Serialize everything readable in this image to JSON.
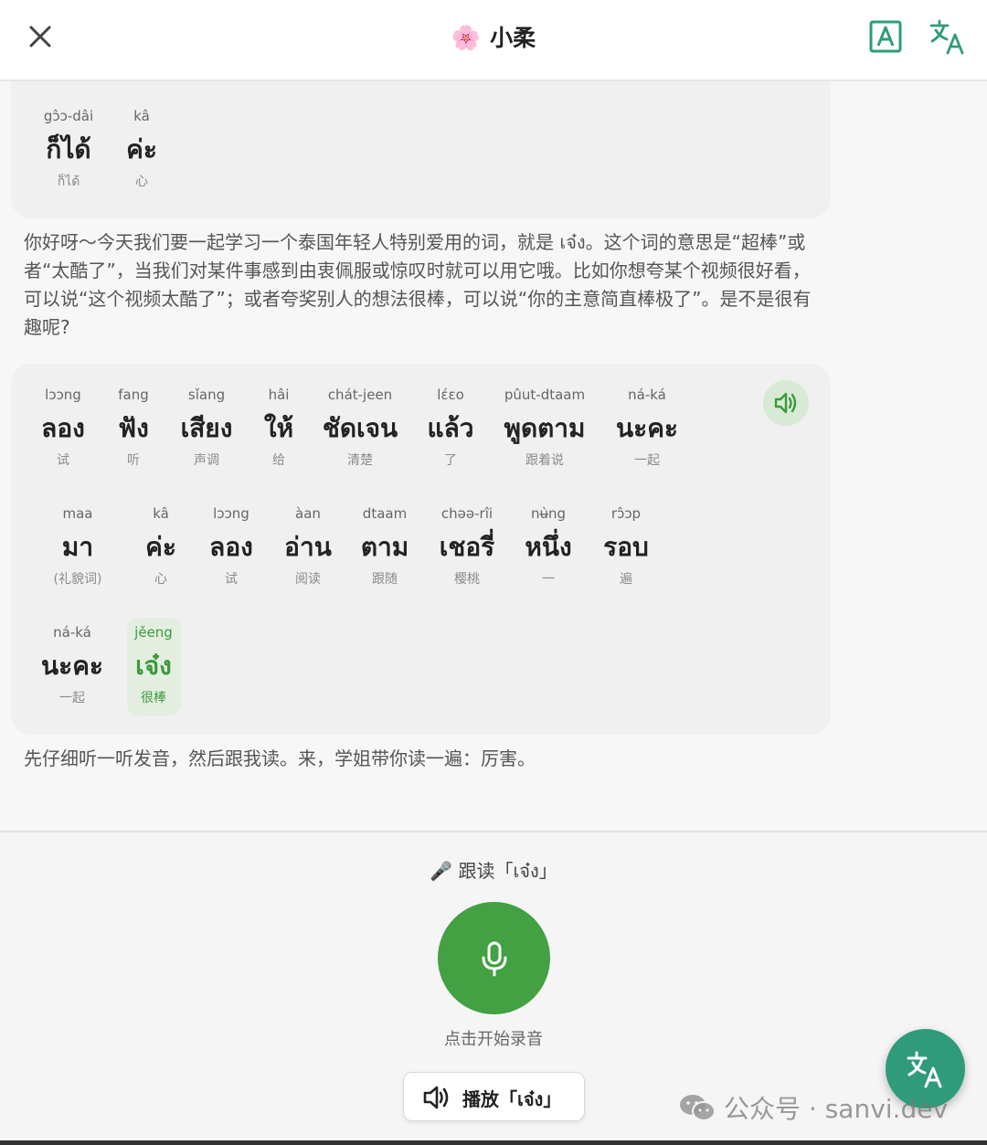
{
  "header": {
    "title": "小柔",
    "flower_emoji": "🌸",
    "accent_color": "#2f9b7a"
  },
  "card1": {
    "words": [
      {
        "rom": "gɔ̂ɔ-dâi",
        "thai": "ก็ได้",
        "mean": "ก็ได้"
      },
      {
        "rom": "kâ",
        "thai": "ค่ะ",
        "mean": "心"
      }
    ]
  },
  "paragraph1": "你好呀～今天我们要一起学习一个泰国年轻人特别爱用的词，就是 เจ๋ง。这个词的意思是“超棒”或者“太酷了”，当我们对某件事感到由衷佩服或惊叹时就可以用它哦。比如你想夸某个视频很好看，可以说“这个视频太酷了”；或者夸奖别人的想法很棒，可以说“你的主意简直棒极了”。是不是很有趣呢?",
  "card2": {
    "row1": [
      {
        "rom": "lɔɔng",
        "thai": "ลอง",
        "mean": "试"
      },
      {
        "rom": "fang",
        "thai": "ฟัง",
        "mean": "听"
      },
      {
        "rom": "sǐang",
        "thai": "เสียง",
        "mean": "声调"
      },
      {
        "rom": "hâi",
        "thai": "ให้",
        "mean": "给"
      },
      {
        "rom": "chát-jeen",
        "thai": "ชัดเจน",
        "mean": "清楚"
      },
      {
        "rom": "lɛ́ɛo",
        "thai": "แล้ว",
        "mean": "了"
      },
      {
        "rom": "pûut-dtaam",
        "thai": "พูดตาม",
        "mean": "跟着说"
      },
      {
        "rom": "ná-ká",
        "thai": "นะคะ",
        "mean": "一起"
      }
    ],
    "row2": [
      {
        "rom": "maa",
        "thai": "มา",
        "mean": "(礼貌词)"
      },
      {
        "rom": "kâ",
        "thai": "ค่ะ",
        "mean": "心"
      },
      {
        "rom": "lɔɔng",
        "thai": "ลอง",
        "mean": "试"
      },
      {
        "rom": "àan",
        "thai": "อ่าน",
        "mean": "阅读"
      },
      {
        "rom": "dtaam",
        "thai": "ตาม",
        "mean": "跟随"
      },
      {
        "rom": "chəə-rîi",
        "thai": "เชอรี่",
        "mean": "樱桃"
      },
      {
        "rom": "nʉ̀ng",
        "thai": "หนึ่ง",
        "mean": "一"
      },
      {
        "rom": "rɔ̂ɔp",
        "thai": "รอบ",
        "mean": "遍"
      }
    ],
    "row3": [
      {
        "rom": "ná-ká",
        "thai": "นะคะ",
        "mean": "一起"
      },
      {
        "rom": "jěeng",
        "thai": "เจ๋ง",
        "mean": "很棒",
        "highlight": true
      }
    ],
    "highlight_color": "#3a9a3a"
  },
  "paragraph2": "先仔细听一听发音，然后跟我读。来，学姐带你读一遍：厉害。",
  "bottom": {
    "follow_label": "🎤 跟读「เจ๋ง」",
    "mic_hint": "点击开始录音",
    "play_label": "播放「เจ๋ง」",
    "mic_color": "#43a043"
  },
  "watermark": "公众号 · sanvi.dev"
}
